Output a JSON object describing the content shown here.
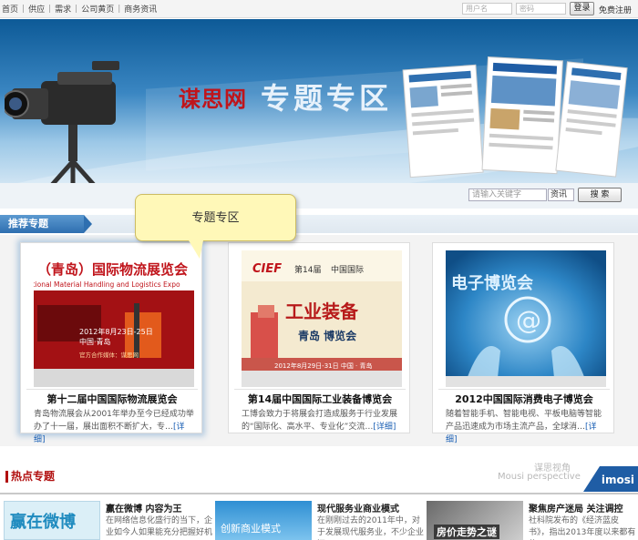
{
  "topnav": {
    "items": [
      "首页",
      "供应",
      "需求",
      "公司黄页",
      "商务资讯"
    ],
    "username_placeholder": "用户名",
    "password_placeholder": "密码",
    "login_label": "登录",
    "register_label": "免费注册"
  },
  "banner": {
    "title": "谋思网",
    "subtitle": "专题专区"
  },
  "search": {
    "placeholder": "请输入关键字",
    "category": "资讯",
    "button": "搜 索"
  },
  "recommended": {
    "title": "推荐专题",
    "tooltip": "专题专区",
    "cards": [
      {
        "name": "第十二届中国国际物流展览会",
        "desc": "青岛物流展会从2001年举办至今已经成功举办了十一届，展出面积不断扩大，专…",
        "more": "[详细]",
        "poster_headline": "（青岛）国际物流展览会",
        "poster_en": "ational Material Handling and Logistics Expo",
        "poster_date": "2012年8月23日-25日",
        "poster_city": "中国·青岛",
        "poster_partner": "官方合作媒体：谋思网"
      },
      {
        "name": "第14届中国国际工业装备博览会",
        "desc": "工博会致力于将展会打造成服务于行业发展的“国际化、高水平、专业化”交流…",
        "more": "[详细]",
        "poster_logo": "CIEF",
        "poster_edition": "第14届",
        "poster_intl": "中国国际",
        "poster_headline": "工业装备",
        "poster_sub": "青岛 博览会",
        "poster_date": "2012年8月29日-31日 中国 · 青岛"
      },
      {
        "name": "2012中国国际消费电子博览会",
        "desc": "随着智能手机、智能电视、平板电脑等智能产品迅速成为市场主流产品，全球消…",
        "more": "[详细]",
        "poster_headline": "电子博览会"
      }
    ]
  },
  "hot": {
    "title": "热点专题",
    "brand_cn": "谋思视角",
    "brand_en": "Mousi perspective",
    "brand_logo": "imosi",
    "items": [
      {
        "title": "赢在微博 内容为王",
        "desc": "在网络信息化盛行的当下，企业如今人如果能充分把握好机",
        "img_text": "赢在微博"
      },
      {
        "title": "现代服务业商业模式",
        "desc": "在刚刚过去的2011年中，对于发展现代服务业，不少企业还",
        "img_text": "创新商业模式"
      },
      {
        "title": "聚焦房产迷局 关注调控",
        "desc": "社科院发布的《经济蓝皮书》，指出2013年度以来都有些",
        "img_text": "房价走势之谜"
      }
    ]
  },
  "colors": {
    "accent_blue": "#2e6fb0",
    "hot_red": "#b10f0f",
    "tooltip_bg": "#fff8b8"
  }
}
